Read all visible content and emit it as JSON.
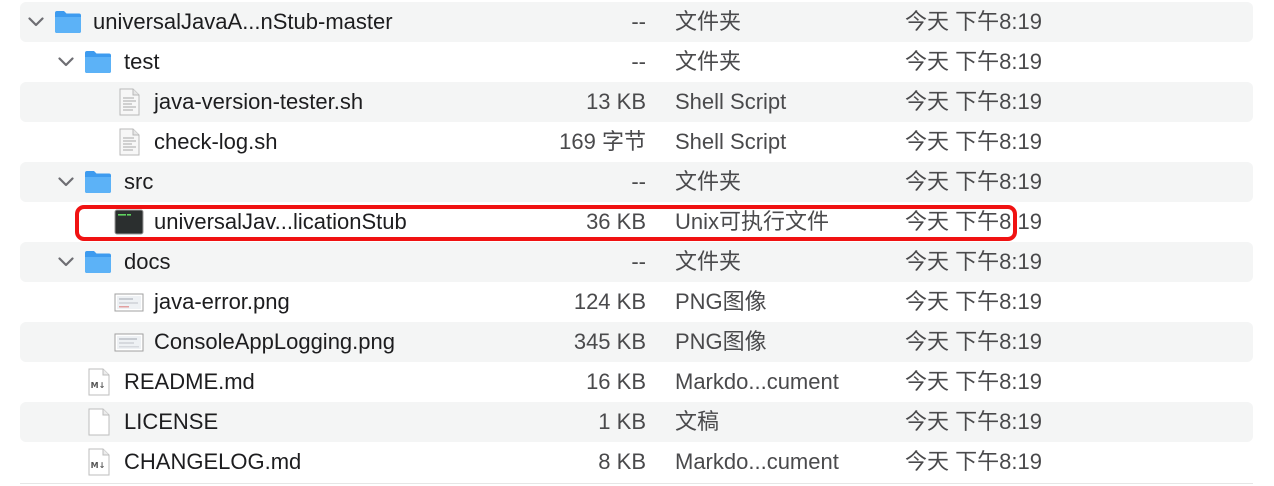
{
  "rows": [
    {
      "name": "universalJavaA...nStub-master",
      "size": "--",
      "kind": "文件夹",
      "date": "今天 下午8:19",
      "icon": "folder-icon",
      "expanded": true
    },
    {
      "name": "test",
      "size": "--",
      "kind": "文件夹",
      "date": "今天 下午8:19",
      "icon": "folder-icon",
      "expanded": true
    },
    {
      "name": "java-version-tester.sh",
      "size": "13 KB",
      "kind": "Shell Script",
      "date": "今天 下午8:19",
      "icon": "script-file-icon"
    },
    {
      "name": "check-log.sh",
      "size": "169 字节",
      "kind": "Shell Script",
      "date": "今天 下午8:19",
      "icon": "script-file-icon"
    },
    {
      "name": "src",
      "size": "--",
      "kind": "文件夹",
      "date": "今天 下午8:19",
      "icon": "folder-icon",
      "expanded": true
    },
    {
      "name": "universalJav...licationStub",
      "size": "36 KB",
      "kind": "Unix可执行文件",
      "date": "今天 下午8:19",
      "icon": "terminal-executable-icon",
      "highlighted": true
    },
    {
      "name": "docs",
      "size": "--",
      "kind": "文件夹",
      "date": "今天 下午8:19",
      "icon": "folder-icon",
      "expanded": true
    },
    {
      "name": "java-error.png",
      "size": "124 KB",
      "kind": "PNG图像",
      "date": "今天 下午8:19",
      "icon": "image-file-icon"
    },
    {
      "name": "ConsoleAppLogging.png",
      "size": "345 KB",
      "kind": "PNG图像",
      "date": "今天 下午8:19",
      "icon": "image-file-icon"
    },
    {
      "name": "README.md",
      "size": "16 KB",
      "kind": "Markdo...cument",
      "date": "今天 下午8:19",
      "icon": "markdown-file-icon"
    },
    {
      "name": "LICENSE",
      "size": "1 KB",
      "kind": "文稿",
      "date": "今天 下午8:19",
      "icon": "document-file-icon"
    },
    {
      "name": "CHANGELOG.md",
      "size": "8 KB",
      "kind": "Markdo...cument",
      "date": "今天 下午8:19",
      "icon": "markdown-file-icon"
    }
  ],
  "colors": {
    "folder": "#3d9bef",
    "stripe": "#f4f5f5",
    "highlight": "#f01212"
  }
}
